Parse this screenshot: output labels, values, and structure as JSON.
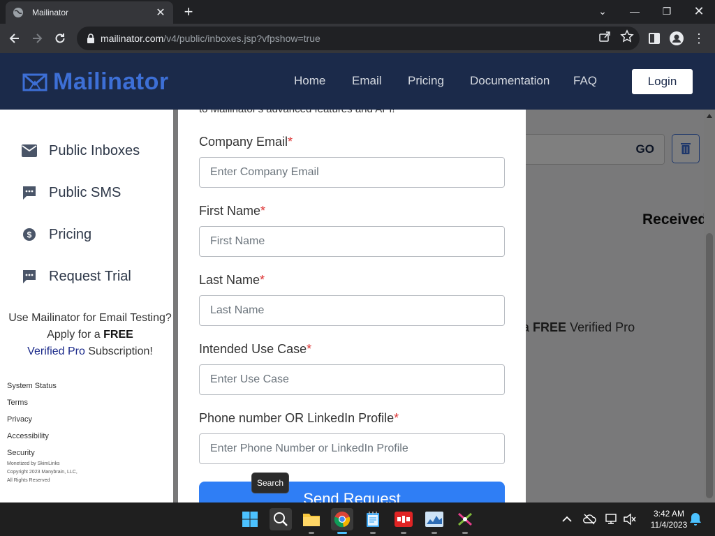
{
  "browser": {
    "tab_title": "Mailinator",
    "url_host": "mailinator.com",
    "url_path": "/v4/public/inboxes.jsp?vfpshow=true"
  },
  "header": {
    "logo_text": "Mailinator",
    "nav": [
      "Home",
      "Email",
      "Pricing",
      "Documentation",
      "FAQ"
    ],
    "login_label": "Login"
  },
  "background": {
    "go_label": "GO",
    "received_label": "Received",
    "promo_free": "FREE",
    "promo_rest": "Verified Pro",
    "promo_prefix": "a"
  },
  "sidebar": {
    "items": [
      {
        "label": "Public Inboxes",
        "icon": "envelope-icon"
      },
      {
        "label": "Public SMS",
        "icon": "sms-icon"
      },
      {
        "label": "Pricing",
        "icon": "dollar-icon"
      },
      {
        "label": "Request Trial",
        "icon": "chat-icon"
      }
    ],
    "promo_line1": "Use Mailinator for Email Testing?",
    "promo_line2a": "Apply for a ",
    "promo_free": "FREE",
    "promo_vp": "Verified Pro",
    "promo_sub": " Subscription!",
    "footer_links": [
      "System Status",
      "Terms",
      "Privacy",
      "Accessibility",
      "Security"
    ],
    "monetized": "Monetized by SkimLinks",
    "copyright": "Copyright 2023 Manybrain, LLC,",
    "rights": "All Rights Reserved"
  },
  "modal": {
    "cut_text": "to Mailinator's advanced features and API!",
    "required_mark": "*",
    "fields": [
      {
        "label": "Company Email",
        "placeholder": "Enter Company Email"
      },
      {
        "label": "First Name",
        "placeholder": "First Name"
      },
      {
        "label": "Last Name",
        "placeholder": "Last Name"
      },
      {
        "label": "Intended Use Case",
        "placeholder": "Enter Use Case"
      },
      {
        "label": "Phone number OR LinkedIn Profile",
        "placeholder": "Enter Phone Number or LinkedIn Profile"
      }
    ],
    "submit_label": "Send Request"
  },
  "tooltip": "Search",
  "taskbar": {
    "time": "3:42 AM",
    "date": "11/4/2023"
  },
  "colors": {
    "header_bg": "#1b2a4a",
    "accent": "#3d6fd6",
    "button": "#2f7ef5"
  }
}
